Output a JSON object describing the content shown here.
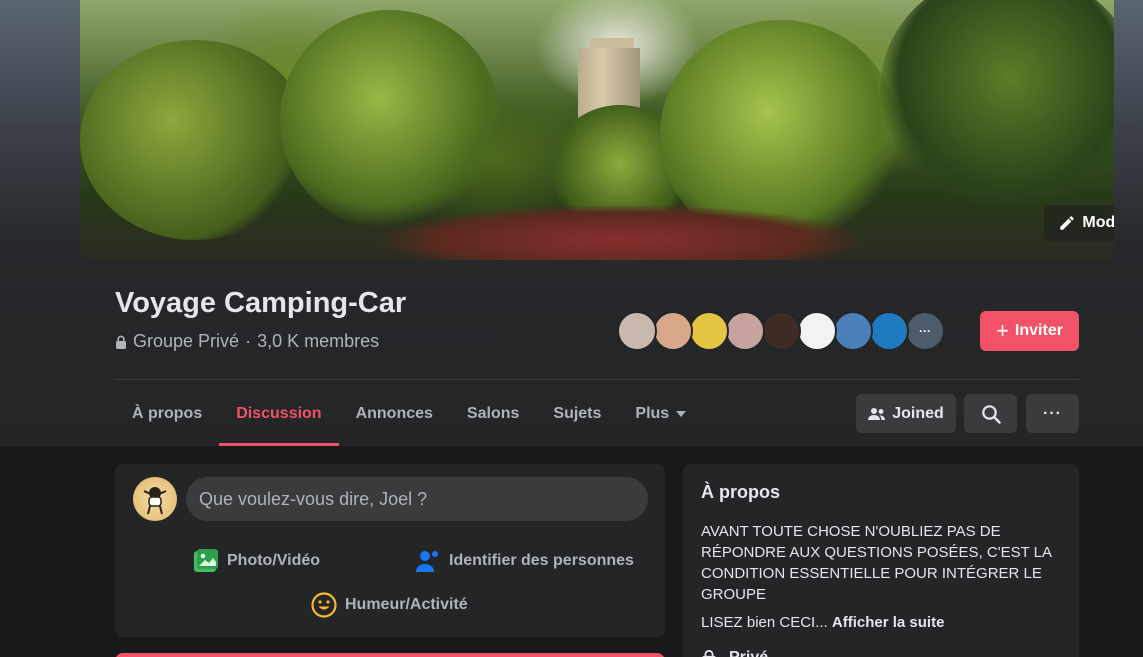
{
  "cover": {
    "edit_label": "Modifier"
  },
  "group": {
    "title": "Voyage Camping-Car",
    "privacy": "Groupe Privé",
    "separator": "·",
    "members": "3,0 K membres"
  },
  "member_avatars": [
    {
      "label": "",
      "color": "#c9b8ad"
    },
    {
      "label": "",
      "color": "#d9a78a"
    },
    {
      "label": "",
      "color": "#e3c542"
    },
    {
      "label": "",
      "color": "#c7a3a0"
    },
    {
      "label": "",
      "color": "#3d2b26"
    },
    {
      "label": "",
      "color": "#f2f2f2"
    },
    {
      "label": "",
      "color": "#4a7fb7"
    },
    {
      "label": "",
      "color": "#1f7bc0"
    },
    {
      "label": "···",
      "color": "#4e5b6a"
    }
  ],
  "invite": {
    "label": "Inviter"
  },
  "tabs": [
    {
      "label": "À propos"
    },
    {
      "label": "Discussion",
      "active": true
    },
    {
      "label": "Annonces"
    },
    {
      "label": "Salons"
    },
    {
      "label": "Sujets"
    },
    {
      "label": "Plus"
    }
  ],
  "actions": {
    "joined_label": "Joined",
    "more_label": "···"
  },
  "composer": {
    "placeholder": "Que voulez-vous dire, Joel ?",
    "photo_label": "Photo/Vidéo",
    "tag_label": "Identifier des personnes",
    "feeling_label": "Humeur/Activité"
  },
  "about": {
    "title": "À propos",
    "description": "AVANT TOUTE CHOSE N'OUBLIEZ PAS DE RÉPONDRE AUX QUESTIONS POSÉES, C'EST LA CONDITION ESSENTIELLE POUR INTÉGRER LE GROUPE",
    "more_prefix": "LISEZ bien CECI...",
    "more_link": "Afficher la suite",
    "privacy_label": "Privé"
  },
  "colors": {
    "accent": "#f25268",
    "surface": "#242526",
    "background": "#18191a"
  }
}
